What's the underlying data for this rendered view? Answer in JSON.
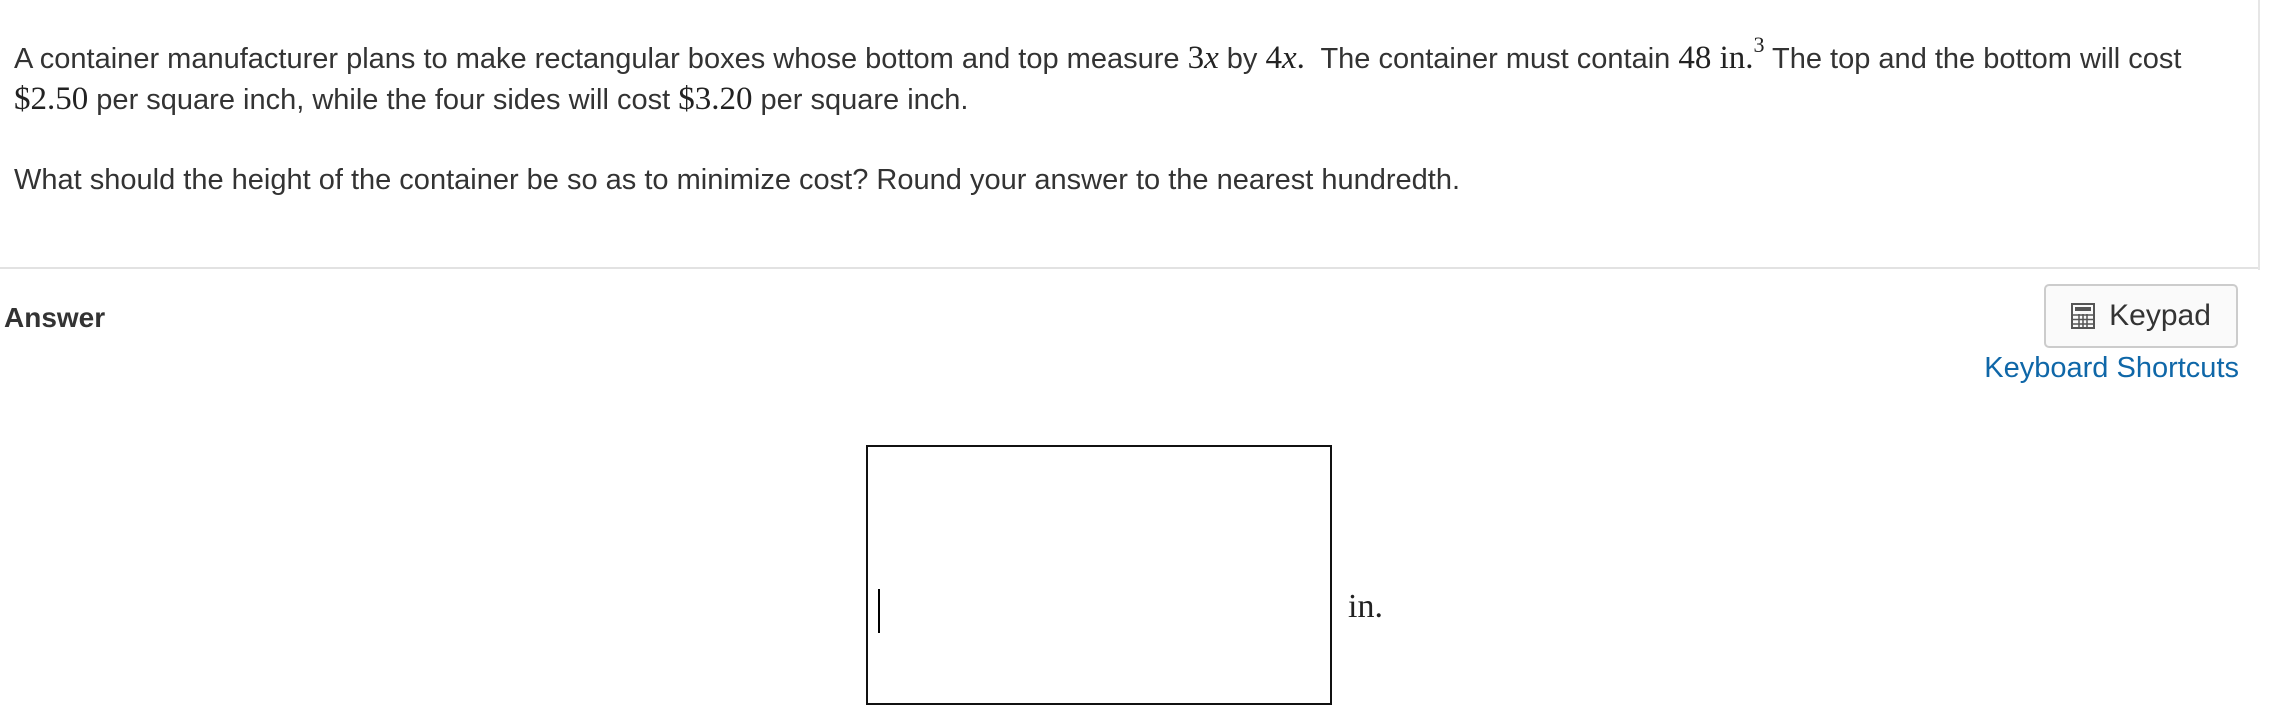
{
  "question": {
    "p1": [
      "A container manufacturer plans to make rectangular boxes whose bottom and top measure ",
      "3",
      "x",
      " by ",
      "4",
      "x",
      ".",
      "  The container must contain ",
      "48 in.",
      "3",
      " The top and the bottom will cost ",
      "$2.50",
      " per square inch, while the four sides will cost ",
      "$3.20",
      " per square inch."
    ],
    "p2": "What should the height of the container be so as to minimize cost? Round your answer to the nearest hundredth."
  },
  "answer": {
    "label": "Answer",
    "input_value": "",
    "unit": "in."
  },
  "keypad": {
    "label": "Keypad",
    "icon": "calculator-icon"
  },
  "shortcuts": {
    "label": "Keyboard Shortcuts"
  },
  "colors": {
    "text": "#333333",
    "link": "#0f67a8",
    "divider": "#e2e2e2",
    "input_border": "#111111"
  }
}
